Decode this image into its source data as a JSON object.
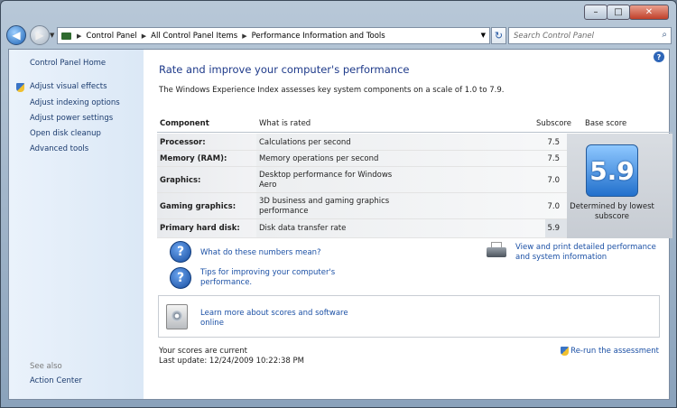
{
  "window": {
    "caption": {
      "minimize": "–",
      "maximize": "□",
      "close": "✕"
    }
  },
  "nav": {
    "back_icon": "back-arrow-icon",
    "forward_icon": "forward-arrow-icon",
    "breadcrumb": [
      "Control Panel",
      "All Control Panel Items",
      "Performance Information and Tools"
    ],
    "search_placeholder": "Search Control Panel"
  },
  "sidebar": {
    "home": "Control Panel Home",
    "items": [
      {
        "label": "Adjust visual effects",
        "shield": true
      },
      {
        "label": "Adjust indexing options",
        "shield": false
      },
      {
        "label": "Adjust power settings",
        "shield": false
      },
      {
        "label": "Open disk cleanup",
        "shield": false
      },
      {
        "label": "Advanced tools",
        "shield": false
      }
    ],
    "see_also_title": "See also",
    "see_also": [
      "Action Center"
    ]
  },
  "main": {
    "title": "Rate and improve your computer's performance",
    "intro": "The Windows Experience Index assesses key system components on a scale of 1.0 to 7.9.",
    "table": {
      "headers": {
        "component": "Component",
        "what": "What is rated",
        "subscore": "Subscore",
        "base": "Base score"
      },
      "rows": [
        {
          "component": "Processor:",
          "what": "Calculations per second",
          "subscore": "7.5"
        },
        {
          "component": "Memory (RAM):",
          "what": "Memory operations per second",
          "subscore": "7.5"
        },
        {
          "component": "Graphics:",
          "what": "Desktop performance for Windows Aero",
          "subscore": "7.0"
        },
        {
          "component": "Gaming graphics:",
          "what": "3D business and gaming graphics performance",
          "subscore": "7.0"
        },
        {
          "component": "Primary hard disk:",
          "what": "Disk data transfer rate",
          "subscore": "5.9"
        }
      ],
      "base_score": "5.9",
      "base_note": "Determined by lowest subscore"
    },
    "links": {
      "numbers": "What do these numbers mean?",
      "tips": "Tips for improving your computer's performance.",
      "print": "View and print detailed performance and system information",
      "learn": "Learn more about scores and software online"
    },
    "status": {
      "current": "Your scores are current",
      "last_update": "Last update: 12/24/2009 10:22:38 PM",
      "rerun": "Re-run the assessment"
    }
  }
}
